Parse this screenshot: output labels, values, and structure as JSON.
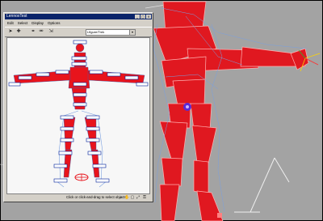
{
  "window": {
    "title": "LennoxTest",
    "menu": [
      "Edit",
      "Select",
      "Display",
      "Options"
    ],
    "name_field": "Lfigure/Trek",
    "status_text": "Click or click-and-drag to select objects"
  },
  "icons": {
    "min": "minimize-icon",
    "max": "maximize-icon",
    "close": "close-icon",
    "toolbar": [
      "select-arrow-icon",
      "add-icon",
      "link-icon",
      "unlink-icon",
      "scale-icon"
    ],
    "status": [
      "zoom-icon",
      "pan-icon",
      "region-icon",
      "fit-icon",
      "lock-icon"
    ]
  },
  "colors": {
    "body_red": "#e8141c",
    "viewport_bg": "#a3a3a3",
    "window_bg": "#d4d0c8",
    "title_blue": "#0a246a",
    "box_blue": "#001e9a",
    "wire_blue": "#7aa0e0"
  }
}
